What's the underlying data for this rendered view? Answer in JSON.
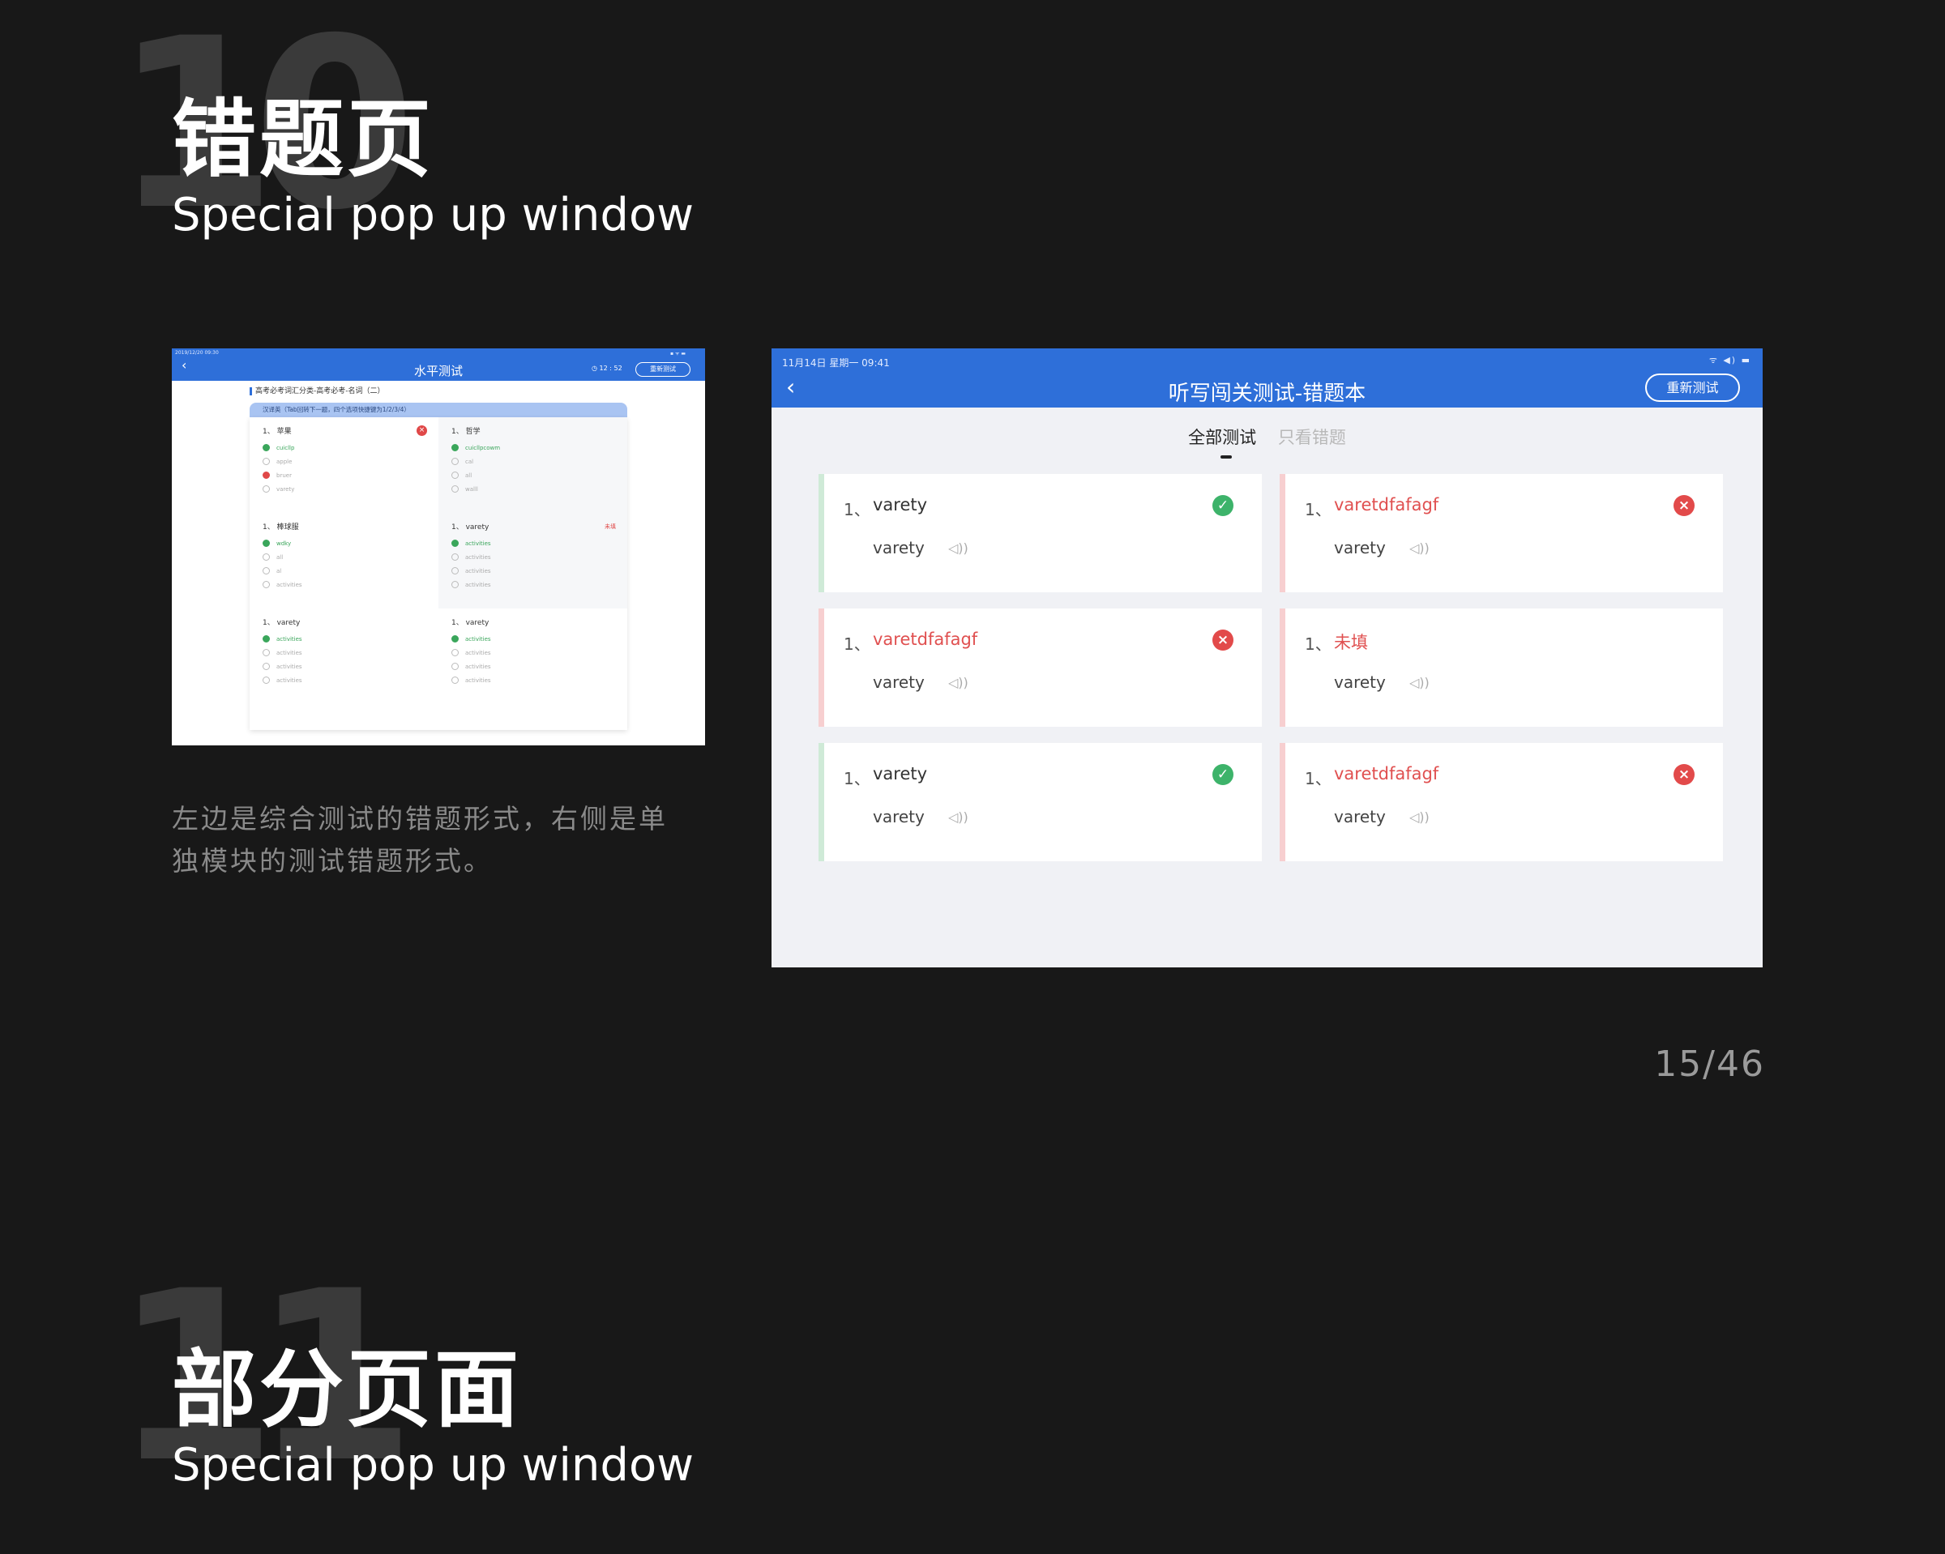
{
  "section10": {
    "number": "10",
    "title": "错题页",
    "subtitle": "Special pop up window"
  },
  "section11": {
    "number": "11",
    "title": "部分页面",
    "subtitle": "Special pop up window"
  },
  "description": "左边是综合测试的错题形式，右侧是单独模块的测试错题形式。",
  "page_number": "15/46",
  "left_screen": {
    "status_time": "2019/12/20  09:30",
    "status_icons": "▪ ᯤ ▬",
    "back_icon": "chevron-left-icon",
    "title": "水平测试",
    "timer": "◷ 12 : 52",
    "retest_label": "重新测试",
    "breadcrumb": "高考必考词汇分类-高考必考-名词（二）",
    "hint": "汉译英（Tab回转下一题，四个选项快捷键为1/2/3/4）",
    "questions": [
      {
        "head": "1、 苹果",
        "mark": "wrong",
        "options": [
          {
            "text": "cuicllp",
            "state": "ok"
          },
          {
            "text": "apple",
            "state": "none"
          },
          {
            "text": "bruer",
            "state": "bad"
          },
          {
            "text": "varety",
            "state": "none"
          }
        ]
      },
      {
        "head": "1、 哲学",
        "mark": "",
        "options": [
          {
            "text": "cuicllpcowm",
            "state": "ok"
          },
          {
            "text": "cal",
            "state": "none"
          },
          {
            "text": "all",
            "state": "none"
          },
          {
            "text": "walll",
            "state": "none"
          }
        ]
      },
      {
        "head": "1、 棒球服",
        "mark": "",
        "options": [
          {
            "text": "wdky",
            "state": "ok"
          },
          {
            "text": "all",
            "state": "none"
          },
          {
            "text": "al",
            "state": "none"
          },
          {
            "text": "activities",
            "state": "none"
          }
        ]
      },
      {
        "head": "1、 varety",
        "mark": "未填",
        "options": [
          {
            "text": "activities",
            "state": "ok"
          },
          {
            "text": "activities",
            "state": "none"
          },
          {
            "text": "activities",
            "state": "none"
          },
          {
            "text": "activities",
            "state": "none"
          }
        ]
      },
      {
        "head": "1、 varety",
        "mark": "",
        "options": [
          {
            "text": "activities",
            "state": "ok"
          },
          {
            "text": "activities",
            "state": "none"
          },
          {
            "text": "activities",
            "state": "none"
          },
          {
            "text": "activities",
            "state": "none"
          }
        ]
      },
      {
        "head": "1、 varety",
        "mark": "",
        "options": [
          {
            "text": "activities",
            "state": "ok"
          },
          {
            "text": "activities",
            "state": "none"
          },
          {
            "text": "activities",
            "state": "none"
          },
          {
            "text": "activities",
            "state": "none"
          }
        ]
      }
    ]
  },
  "right_screen": {
    "status_time": "11月14日 星期一  09:41",
    "status_icons": "ᯤ ◀) ▬",
    "back_icon": "chevron-left-icon",
    "title": "听写闯关测试-错题本",
    "retest_label": "重新测试",
    "tab_all": "全部测试",
    "tab_wrong_only": "只看错题",
    "cards": [
      {
        "num": "1、",
        "word": "varety",
        "answer": "varety",
        "result": "correct"
      },
      {
        "num": "1、",
        "word": "varetdfafagf",
        "answer": "varety",
        "result": "wrong"
      },
      {
        "num": "1、",
        "word": "varetdfafagf",
        "answer": "varety",
        "result": "wrong"
      },
      {
        "num": "1、",
        "word": "未填",
        "answer": "varety",
        "result": "unfilled"
      },
      {
        "num": "1、",
        "word": "varety",
        "answer": "varety",
        "result": "correct"
      },
      {
        "num": "1、",
        "word": "varetdfafagf",
        "answer": "varety",
        "result": "wrong"
      }
    ]
  },
  "colors": {
    "background": "#181818",
    "brand_blue": "#2e6fd9",
    "correct_green": "#3db36a",
    "wrong_red": "#e24a4a"
  }
}
